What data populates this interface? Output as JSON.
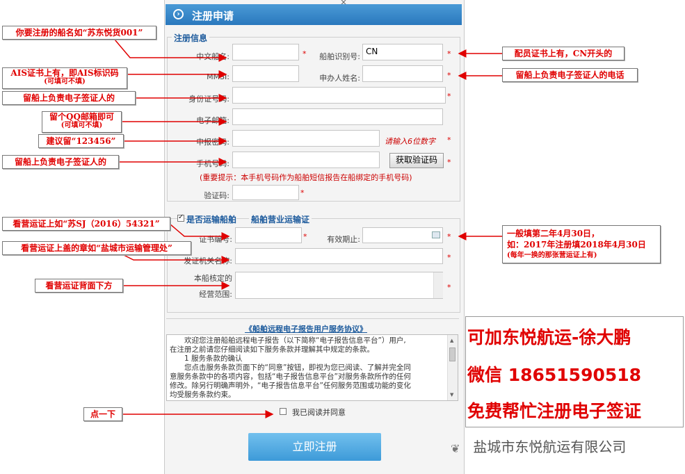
{
  "header": {
    "title": "注册申请",
    "icon": "chevron-right-circle-icon",
    "close_glyph": "×"
  },
  "reg_info": {
    "section_title": "注册信息",
    "cn_name_label": "中文船名:",
    "cn_name_value": "",
    "ship_id_label": "船舶识别号:",
    "ship_id_value": "CN",
    "mmsi_label": "MMSI:",
    "mmsi_value": "",
    "applicant_label": "申办人姓名:",
    "applicant_value": "",
    "id_label": "身份证号码:",
    "id_value": "",
    "email_label": "电子邮箱:",
    "email_value": "",
    "pwd_label": "申报密码:",
    "pwd_value": "",
    "pwd_hint": "请输入6位数字",
    "phone_label": "手机号码:",
    "phone_value": "",
    "get_code_button": "获取验证码",
    "phone_notice": "(重要提示：本手机号码作为船舶短信报告在船绑定的手机号码)",
    "code_label": "验证码:",
    "code_value": ""
  },
  "transport": {
    "checkbox_label": "是否运输船舶",
    "checkbox_checked": true,
    "section_title": "船舶营业运输证",
    "cert_no_label": "证书编号:",
    "cert_no_value": "",
    "valid_label": "有效期止:",
    "valid_value": "",
    "issuer_label": "发证机关名称:",
    "issuer_value": "",
    "scope_label_1": "本船核定的",
    "scope_label_2": "经营范围:",
    "scope_value": ""
  },
  "required_mark": "*",
  "agreement": {
    "title": "《船舶远程电子报告用户服务协议》",
    "lines": [
      "　　欢迎您注册船舶远程电子报告（以下简称“电子报告信息平台”）用户,",
      "在注册之前请您仔细阅读如下服务条款并理解其中规定的条款。",
      "　　1 服务条款的确认",
      "　　您点击服务条款页面下的“同意”按钮，即视为您已阅读、了解并完全同",
      "意服务条款中的各项内容，包括“电子报告信息平台”对服务条款所作的任何",
      "修改。除另行明确声明外，“电子报告信息平台”任何服务范围或功能的变化",
      "均受服务条款约束。"
    ],
    "agree_label": "我已阅读并同意",
    "agree_checked": false
  },
  "submit_label": "立即注册",
  "notes": {
    "ship_name": "你要注册的船名如“苏东悦货001”",
    "mmsi": "AIS证书上有，即AIS标识码",
    "mmsi_sub": "(可填可不填)",
    "id": "留船上负责电子签证人的",
    "email": "留个QQ邮箱即可",
    "email_sub": "(可填可不填)",
    "pwd": "建议留“123456”",
    "phone": "留船上负责电子签证人的",
    "ship_id": "配员证书上有，CN开头的",
    "applicant": "留船上负责电子签证人的电话",
    "cert_no": "看营运证上如“苏SJ（2016）54321”",
    "issuer": "看营运证上盖的章如“盐城市运输管理处”",
    "scope": "看营运证背面下方",
    "valid_1": "一般填第二年4月30日，",
    "valid_2": "如：2017年注册填2018年4月30日",
    "valid_sub": "(每年一换的那张营运证上有)",
    "agree": "点一下"
  },
  "promo": {
    "line1": "可加东悦航运-徐大鹏",
    "line2": "微信 18651590518",
    "line3": "免费帮忙注册电子签证"
  },
  "watermark": "盐城市东悦航运有限公司",
  "colors": {
    "header_blue": "#2a78bd",
    "annotation_red": "#e00000",
    "submit_blue": "#3d9ad8"
  }
}
